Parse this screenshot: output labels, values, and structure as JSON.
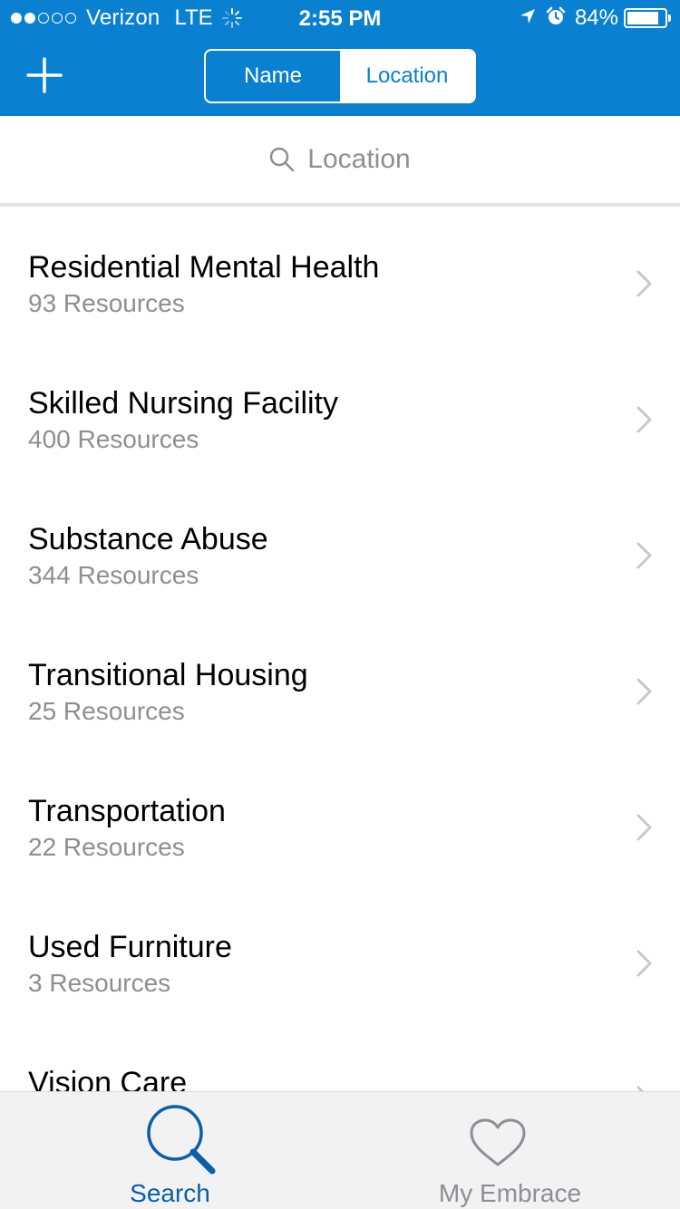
{
  "status_bar": {
    "carrier": "Verizon",
    "network": "LTE",
    "time": "2:55 PM",
    "battery": "84%",
    "battery_level": 0.84,
    "signal_bars_filled": 2,
    "signal_bars_total": 5
  },
  "nav": {
    "add_icon": "plus-icon",
    "segments": [
      {
        "label": "Name",
        "selected": false
      },
      {
        "label": "Location",
        "selected": true
      }
    ]
  },
  "search": {
    "icon": "search-icon",
    "placeholder": "Location"
  },
  "categories": [
    {
      "title": "Residential Mental Health",
      "subtitle": "93 Resources"
    },
    {
      "title": "Skilled Nursing Facility",
      "subtitle": "400 Resources"
    },
    {
      "title": "Substance Abuse",
      "subtitle": "344 Resources"
    },
    {
      "title": "Transitional Housing",
      "subtitle": "25 Resources"
    },
    {
      "title": "Transportation",
      "subtitle": "22 Resources"
    },
    {
      "title": "Used Furniture",
      "subtitle": "3 Resources"
    },
    {
      "title": "Vision Care",
      "subtitle": ""
    }
  ],
  "tabbar": {
    "tabs": [
      {
        "label": "Search",
        "icon": "search-icon",
        "selected": true
      },
      {
        "label": "My Embrace",
        "icon": "heart-icon",
        "selected": false
      }
    ]
  },
  "colors": {
    "brand_blue": "#0a80d0",
    "selected_tab": "#0a5fa8",
    "secondary_text": "#8e8e93"
  }
}
